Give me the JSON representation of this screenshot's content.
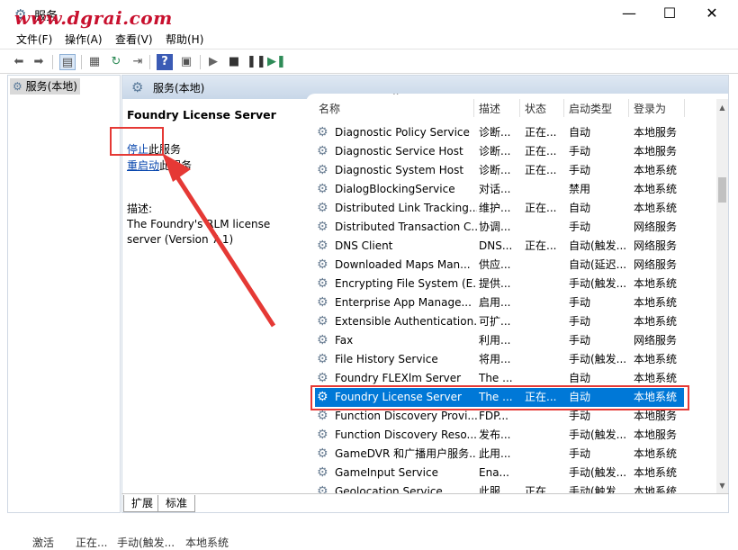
{
  "window": {
    "title": "服务",
    "watermark": "www.dgrai.com",
    "minimize": "—",
    "maximize": "☐",
    "close": "✕"
  },
  "menu": [
    "文件(F)",
    "操作(A)",
    "查看(V)",
    "帮助(H)"
  ],
  "tree": {
    "root": "服务(本地)"
  },
  "pane": {
    "header": "服务(本地)"
  },
  "detail": {
    "title": "Foundry License Server",
    "stop_link": "停止",
    "stop_suffix": "此服务",
    "restart_link": "重启动",
    "restart_suffix": "此服务",
    "desc_label": "描述:",
    "desc_text": "The Foundry's RLM license server (Version 7.1)"
  },
  "columns": [
    "名称",
    "描述",
    "状态",
    "启动类型",
    "登录为"
  ],
  "rows": [
    [
      "Diagnostic Policy Service",
      "诊断...",
      "正在...",
      "自动",
      "本地服务"
    ],
    [
      "Diagnostic Service Host",
      "诊断...",
      "正在...",
      "手动",
      "本地服务"
    ],
    [
      "Diagnostic System Host",
      "诊断...",
      "正在...",
      "手动",
      "本地系统"
    ],
    [
      "DialogBlockingService",
      "对话...",
      "",
      "禁用",
      "本地系统"
    ],
    [
      "Distributed Link Tracking...",
      "维护...",
      "正在...",
      "自动",
      "本地系统"
    ],
    [
      "Distributed Transaction C...",
      "协调...",
      "",
      "手动",
      "网络服务"
    ],
    [
      "DNS Client",
      "DNS...",
      "正在...",
      "自动(触发...",
      "网络服务"
    ],
    [
      "Downloaded Maps Man...",
      "供应...",
      "",
      "自动(延迟...",
      "网络服务"
    ],
    [
      "Encrypting File System (E...",
      "提供...",
      "",
      "手动(触发...",
      "本地系统"
    ],
    [
      "Enterprise App Manage...",
      "启用...",
      "",
      "手动",
      "本地系统"
    ],
    [
      "Extensible Authentication...",
      "可扩...",
      "",
      "手动",
      "本地系统"
    ],
    [
      "Fax",
      "利用...",
      "",
      "手动",
      "网络服务"
    ],
    [
      "File History Service",
      "将用...",
      "",
      "手动(触发...",
      "本地系统"
    ],
    [
      "Foundry FLEXlm Server",
      "The ...",
      "",
      "自动",
      "本地系统"
    ],
    [
      "Foundry License Server",
      "The ...",
      "正在...",
      "自动",
      "本地系统"
    ],
    [
      "Function Discovery Provi...",
      "FDP...",
      "",
      "手动",
      "本地服务"
    ],
    [
      "Function Discovery Reso...",
      "发布...",
      "",
      "手动(触发...",
      "本地服务"
    ],
    [
      "GameDVR 和广播用户服务...",
      "此用...",
      "",
      "手动",
      "本地系统"
    ],
    [
      "GameInput Service",
      "Ena...",
      "",
      "手动(触发...",
      "本地系统"
    ],
    [
      "Geolocation Service",
      "此服...",
      "正在...",
      "手动(触发...",
      "本地系统"
    ]
  ],
  "selected_row": 14,
  "tabs": [
    "扩展",
    "标准"
  ],
  "status": [
    "激活",
    "正在...",
    "手动(触发...",
    "本地系统"
  ],
  "colors": {
    "selection": "#0078d7",
    "annotation": "#e53935",
    "header_bg": "#c8d7e8"
  }
}
